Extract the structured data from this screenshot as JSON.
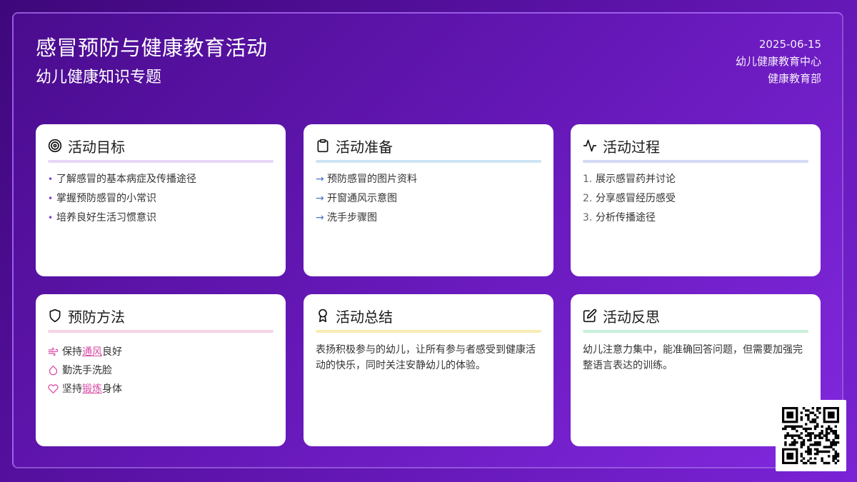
{
  "header": {
    "title": "感冒预防与健康教育活动",
    "subtitle": "幼儿健康知识专题",
    "date": "2025-06-15",
    "org": "幼儿健康教育中心",
    "dept": "健康教育部"
  },
  "cards": {
    "goals": {
      "title": "活动目标",
      "icon": "target-icon",
      "accent": "#e8d6f7",
      "items": [
        "了解感冒的基本病症及传播途径",
        "掌握预防感冒的小常识",
        "培养良好生活习惯意识"
      ]
    },
    "prep": {
      "title": "活动准备",
      "icon": "clipboard-icon",
      "accent": "#cde4f4",
      "items": [
        "预防感冒的图片资料",
        "开窗通风示意图",
        "洗手步骤图"
      ]
    },
    "process": {
      "title": "活动过程",
      "icon": "activity-icon",
      "accent": "#d5d8f5",
      "items": [
        "展示感冒药并讨论",
        "分享感冒经历感受",
        "分析传播途径"
      ]
    },
    "prevention": {
      "title": "预防方法",
      "icon": "shield-icon",
      "accent": "#f6d3e6",
      "items": [
        {
          "pre": "保持",
          "hl": "通风",
          "post": "良好",
          "icon": "wind-icon"
        },
        {
          "pre": "勤洗手洗脸",
          "hl": "",
          "post": "",
          "icon": "droplet-icon"
        },
        {
          "pre": "坚持",
          "hl": "锻炼",
          "post": "身体",
          "icon": "heart-icon"
        }
      ]
    },
    "summary": {
      "title": "活动总结",
      "icon": "award-icon",
      "accent": "#f9ecb4",
      "text": "表扬积极参与的幼儿，让所有参与者感受到健康活动的快乐，同时关注安静幼儿的体验。"
    },
    "reflection": {
      "title": "活动反思",
      "icon": "edit-icon",
      "accent": "#c9f0dc",
      "text": "幼儿注意力集中，能准确回答问题，但需要加强完整语言表达的训练。"
    }
  },
  "colors": {
    "bg_start": "#3e077a",
    "bg_end": "#7a23d6",
    "highlight": "#d94aa5",
    "icon_pink": "#d94aa5"
  }
}
